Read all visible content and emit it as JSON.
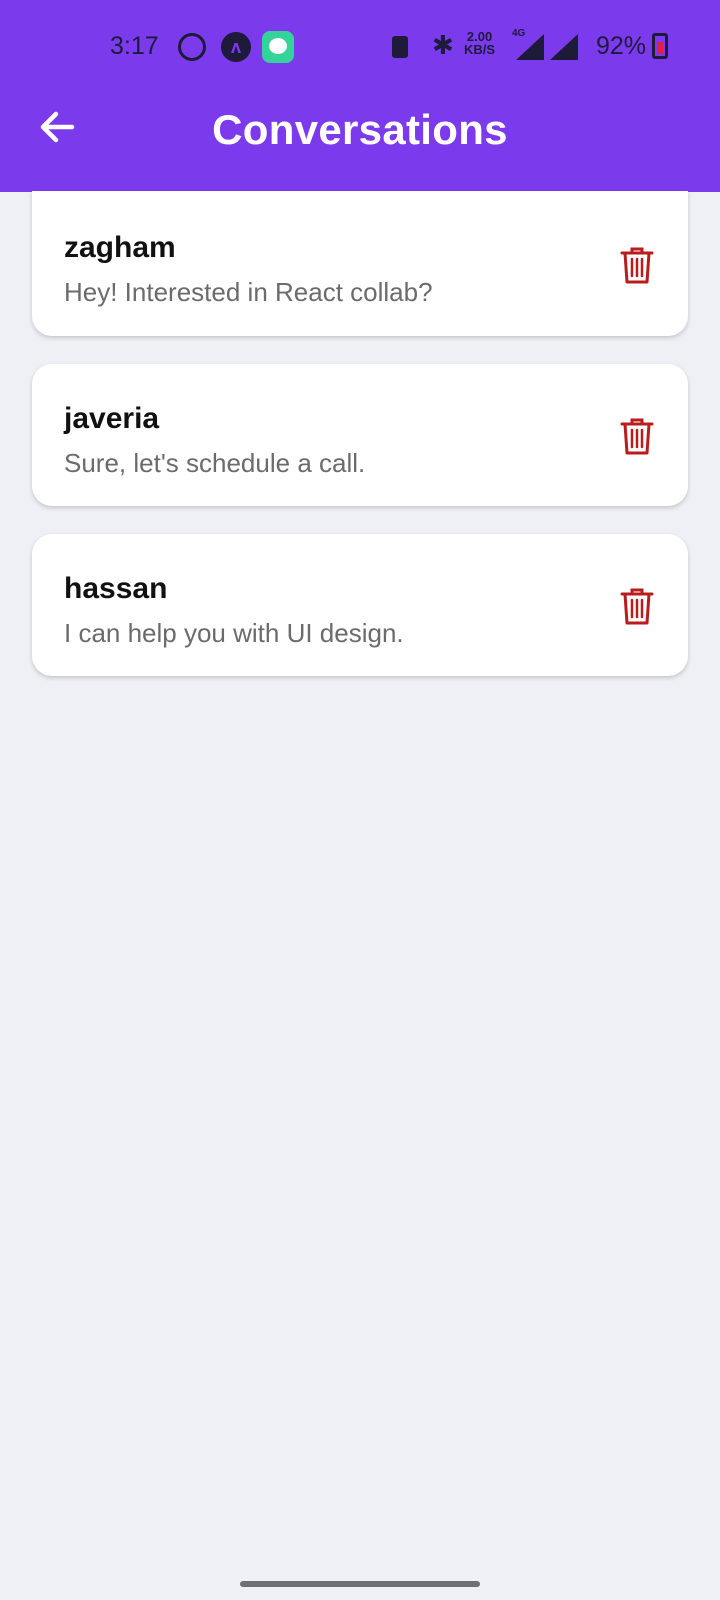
{
  "status_bar": {
    "time": "3:17",
    "battery_percent": "92%",
    "net_speed": "2.00",
    "net_speed_unit": "KB/S",
    "network": "4G"
  },
  "header": {
    "title": "Conversations",
    "background": "#7c3aed"
  },
  "conversations": [
    {
      "name": "zagham",
      "message": "Hey! Interested in React collab?"
    },
    {
      "name": "javeria",
      "message": "Sure, let's schedule a call."
    },
    {
      "name": "hassan",
      "message": "I can help you with UI design."
    }
  ],
  "colors": {
    "accent": "#7c3aed",
    "delete": "#b91c1c",
    "background": "#eff0f5"
  }
}
